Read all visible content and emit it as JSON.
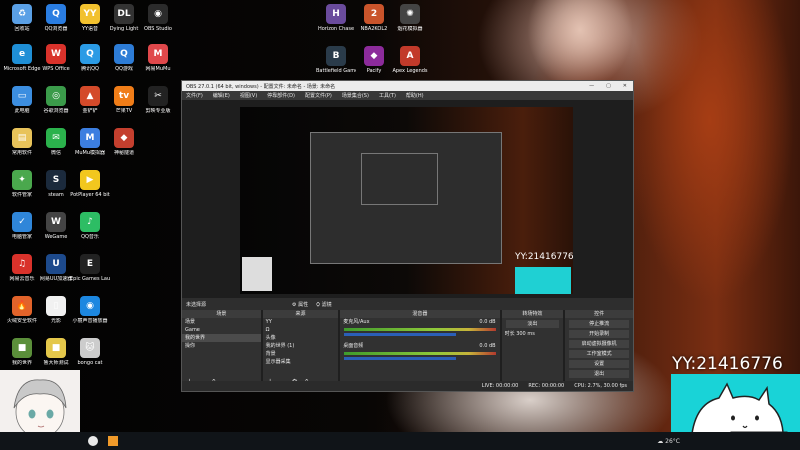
{
  "desktop": {
    "icons": [
      {
        "label": "回收站",
        "color": "#5aa0e6",
        "glyph": "♻"
      },
      {
        "label": "QQ浏览器",
        "color": "#2a7de1",
        "glyph": "Q"
      },
      {
        "label": "YY语音",
        "color": "#f2c12e",
        "glyph": "YY"
      },
      {
        "label": "Dying Light",
        "color": "#333333",
        "glyph": "DL"
      },
      {
        "label": "OBS Studio",
        "color": "#2b2b2b",
        "glyph": "◉"
      },
      {
        "label": "Microsoft Edge",
        "color": "#1f8fd6",
        "glyph": "e"
      },
      {
        "label": "WPS Office",
        "color": "#d9322b",
        "glyph": "W"
      },
      {
        "label": "腾讯QQ",
        "color": "#2b9be5",
        "glyph": "Q"
      },
      {
        "label": "QQ游戏",
        "color": "#2d7cd6",
        "glyph": "Q"
      },
      {
        "label": "网易MuMu",
        "color": "#e0484b",
        "glyph": "M"
      },
      {
        "label": "此电脑",
        "color": "#3c8ee0",
        "glyph": "▭"
      },
      {
        "label": "谷歌浏览器",
        "color": "#3b9b4a",
        "glyph": "◎"
      },
      {
        "label": "金铲铲",
        "color": "#d44a2a",
        "glyph": "▲"
      },
      {
        "label": "芒果TV",
        "color": "#f07d18",
        "glyph": "tv"
      },
      {
        "label": "剪映专业版",
        "color": "#222222",
        "glyph": "✂"
      },
      {
        "label": "常用软件",
        "color": "#e8c35a",
        "glyph": "▤"
      },
      {
        "label": "微信",
        "color": "#2bb24c",
        "glyph": "✉"
      },
      {
        "label": "MuMu模拟器",
        "color": "#3c7ee0",
        "glyph": "M"
      },
      {
        "label": "神秘隧道",
        "color": "#c43f2e",
        "glyph": "◆"
      },
      {
        "label": "软件管家",
        "color": "#4aa84d",
        "glyph": "✦"
      },
      {
        "label": "steam",
        "color": "#1b2a3c",
        "glyph": "S"
      },
      {
        "label": "PotPlayer 64 bit",
        "color": "#f2c71e",
        "glyph": "▶"
      },
      {
        "label": "电脑管家",
        "color": "#2f86d9",
        "glyph": "✓"
      },
      {
        "label": "WeGame",
        "color": "#444444",
        "glyph": "W"
      },
      {
        "label": "QQ音乐",
        "color": "#2dbd64",
        "glyph": "♪"
      },
      {
        "label": "网易云音乐",
        "color": "#d9322b",
        "glyph": "♫"
      },
      {
        "label": "网易UU加速器",
        "color": "#1d4a8c",
        "glyph": "U"
      },
      {
        "label": "Epic Games Launcher",
        "color": "#222222",
        "glyph": "E"
      },
      {
        "label": "火绒安全软件",
        "color": "#e2632a",
        "glyph": "🔥"
      },
      {
        "label": "光影",
        "color": "#f1f1f1",
        "glyph": "▯"
      },
      {
        "label": "小丽声音播放器",
        "color": "#1c87e0",
        "glyph": "◉"
      },
      {
        "label": "我的世界",
        "color": "#5b8f3a",
        "glyph": "■"
      },
      {
        "label": "鲁大师测试",
        "color": "#e4c74a",
        "glyph": "■"
      },
      {
        "label": "bongo cat",
        "color": "#cccccc",
        "glyph": "🐱"
      },
      {
        "label": "Horizon Chase",
        "color": "#6a4b9c",
        "glyph": "H"
      },
      {
        "label": "NBA2KOL2",
        "color": "#c9542b",
        "glyph": "2"
      },
      {
        "label": "烟花模拟器",
        "color": "#444444",
        "glyph": "✺"
      },
      {
        "label": "Battlefield Game",
        "color": "#2a3b4a",
        "glyph": "B"
      },
      {
        "label": "Pacify",
        "color": "#8c2b9b",
        "glyph": "◆"
      },
      {
        "label": "Apex Legends",
        "color": "#c23a2a",
        "glyph": "A"
      }
    ]
  },
  "obs": {
    "title": "OBS 27.0.1 (64 bit, windows) - 配置文件: 未命名 - 场景: 未命名",
    "window_controls": [
      "—",
      "▢",
      "✕"
    ],
    "menu": [
      "文件(F)",
      "编辑(E)",
      "视图(V)",
      "停靠部件(D)",
      "配置文件(P)",
      "场景集合(S)",
      "工具(T)",
      "帮助(H)"
    ],
    "scene_bar": {
      "label": "未选择源",
      "props": "⚙ 属性",
      "filters": "⛭ 滤镜"
    },
    "panels": {
      "scenes": {
        "header": "场景",
        "items": [
          "场景",
          "Game",
          "我的世界",
          "操你"
        ],
        "selected": 2
      },
      "sources": {
        "header": "来源",
        "items": [
          "YY",
          "Ω",
          "头像",
          "我的世界 (1)",
          "背景",
          "显示器采集"
        ]
      },
      "mixer": {
        "header": "混音器",
        "tracks": [
          {
            "name": "麦克风/Aux",
            "db": "0.0 dB"
          },
          {
            "name": "桌面音频",
            "db": "0.0 dB"
          }
        ]
      },
      "transitions": {
        "header": "转场特效",
        "mode": "淡出",
        "duration_label": "时长",
        "duration": "300 ms"
      },
      "controls": {
        "header": "控件",
        "buttons": [
          "停止推流",
          "开始录制",
          "启动虚拟摄像机",
          "工作室模式",
          "设置",
          "退出"
        ]
      }
    },
    "status": {
      "live": "LIVE: 00:00:00",
      "rec": "REC: 00:00:00",
      "cpu": "CPU: 2.7%, 30.00 fps"
    }
  },
  "overlay": {
    "yy_id": "YY:21416776",
    "inner_yy_id": "YY:21416776"
  },
  "taskbar": {
    "weather": "26°C"
  }
}
